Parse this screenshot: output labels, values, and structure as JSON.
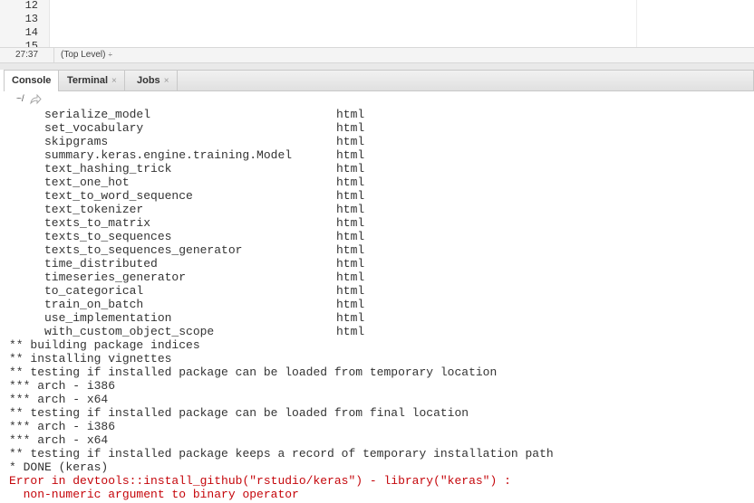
{
  "editor": {
    "line_numbers": [
      "12",
      "13",
      "14",
      "15"
    ]
  },
  "status_bar": {
    "cursor_position": "27:37",
    "scope": "(Top Level)",
    "scope_caret": "÷"
  },
  "tabs": [
    {
      "label": "Console",
      "close": ""
    },
    {
      "label": "Terminal",
      "close": "×"
    },
    {
      "label": "Jobs",
      "close": "×"
    }
  ],
  "console_path": "~/",
  "function_list": [
    {
      "name": "serialize_model",
      "type": "html"
    },
    {
      "name": "set_vocabulary",
      "type": "html"
    },
    {
      "name": "skipgrams",
      "type": "html"
    },
    {
      "name": "summary.keras.engine.training.Model",
      "type": "html"
    },
    {
      "name": "text_hashing_trick",
      "type": "html"
    },
    {
      "name": "text_one_hot",
      "type": "html"
    },
    {
      "name": "text_to_word_sequence",
      "type": "html"
    },
    {
      "name": "text_tokenizer",
      "type": "html"
    },
    {
      "name": "texts_to_matrix",
      "type": "html"
    },
    {
      "name": "texts_to_sequences",
      "type": "html"
    },
    {
      "name": "texts_to_sequences_generator",
      "type": "html"
    },
    {
      "name": "time_distributed",
      "type": "html"
    },
    {
      "name": "timeseries_generator",
      "type": "html"
    },
    {
      "name": "to_categorical",
      "type": "html"
    },
    {
      "name": "train_on_batch",
      "type": "html"
    },
    {
      "name": "use_implementation",
      "type": "html"
    },
    {
      "name": "with_custom_object_scope",
      "type": "html"
    }
  ],
  "log_lines": [
    "** building package indices",
    "** installing vignettes",
    "** testing if installed package can be loaded from temporary location",
    "*** arch - i386",
    "*** arch - x64",
    "** testing if installed package can be loaded from final location",
    "*** arch - i386",
    "*** arch - x64",
    "** testing if installed package keeps a record of temporary installation path",
    "* DONE (keras)"
  ],
  "error_lines": [
    "Error in devtools::install_github(\"rstudio/keras\") - library(\"keras\") :",
    "  non-numeric argument to binary operator"
  ],
  "colors": {
    "error_text": "#c5060b",
    "console_text": "#333333"
  }
}
